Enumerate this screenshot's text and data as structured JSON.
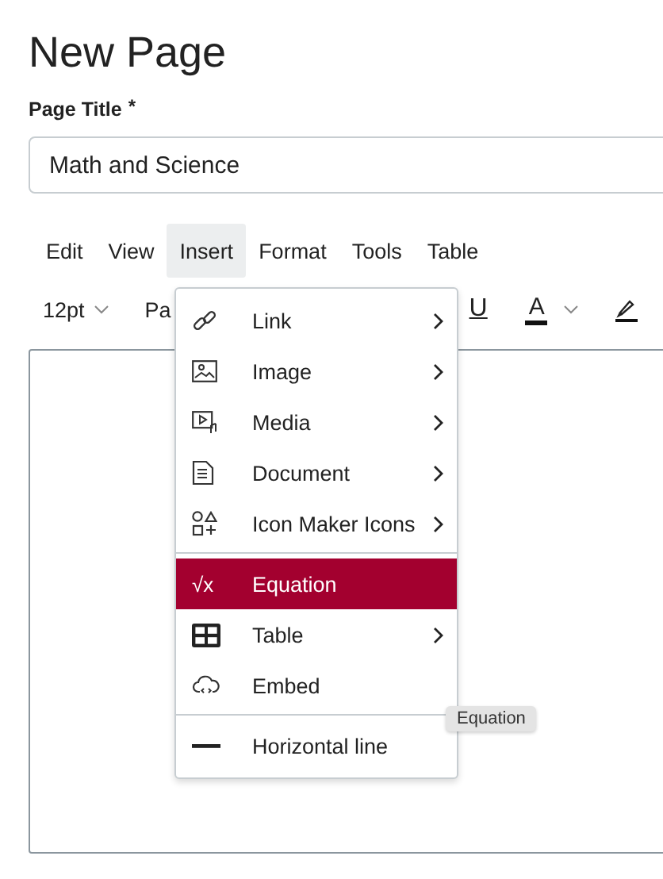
{
  "heading": "New Page",
  "page_title": {
    "label": "Page Title",
    "required_mark": "*",
    "value": "Math and Science"
  },
  "menubar": [
    {
      "label": "Edit",
      "selected": false
    },
    {
      "label": "View",
      "selected": false
    },
    {
      "label": "Insert",
      "selected": true
    },
    {
      "label": "Format",
      "selected": false
    },
    {
      "label": "Tools",
      "selected": false
    },
    {
      "label": "Table",
      "selected": false
    }
  ],
  "toolbar": {
    "font_size": "12pt",
    "paragraph": "Pa",
    "underline": "U",
    "text_color": "A"
  },
  "insert_menu": [
    {
      "kind": "item",
      "label": "Link",
      "submenu": true,
      "selected": false
    },
    {
      "kind": "item",
      "label": "Image",
      "submenu": true,
      "selected": false
    },
    {
      "kind": "item",
      "label": "Media",
      "submenu": true,
      "selected": false
    },
    {
      "kind": "item",
      "label": "Document",
      "submenu": true,
      "selected": false
    },
    {
      "kind": "item",
      "label": "Icon Maker Icons",
      "submenu": true,
      "selected": false
    },
    {
      "kind": "separator"
    },
    {
      "kind": "item",
      "symbol": "√x",
      "label": "Equation",
      "submenu": false,
      "selected": true
    },
    {
      "kind": "item",
      "label": "Table",
      "submenu": true,
      "selected": false
    },
    {
      "kind": "item",
      "label": "Embed",
      "submenu": false,
      "selected": false
    },
    {
      "kind": "separator"
    },
    {
      "kind": "item",
      "label": "Horizontal line",
      "submenu": false,
      "selected": false
    }
  ],
  "tooltip": "Equation"
}
